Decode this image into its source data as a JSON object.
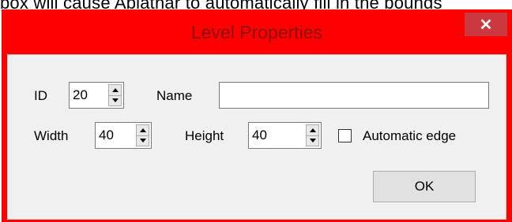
{
  "caption": {
    "text": "box will cause Ablathar to automatically fill in the bounds"
  },
  "window": {
    "title": "Level Properties",
    "close_glyph": "✕",
    "close_icon": "close-icon"
  },
  "form": {
    "id_label": "ID",
    "id_value": "20",
    "name_label": "Name",
    "name_value": "",
    "width_label": "Width",
    "width_value": "40",
    "height_label": "Height",
    "height_value": "40",
    "automatic_edge_label": "Automatic edge",
    "automatic_edge_checked": false
  },
  "buttons": {
    "ok_label": "OK"
  },
  "colors": {
    "frame": "#ff0000",
    "title_text": "#8b1010",
    "close_button": "#c9393f",
    "client_area": "#f0f0f0"
  }
}
